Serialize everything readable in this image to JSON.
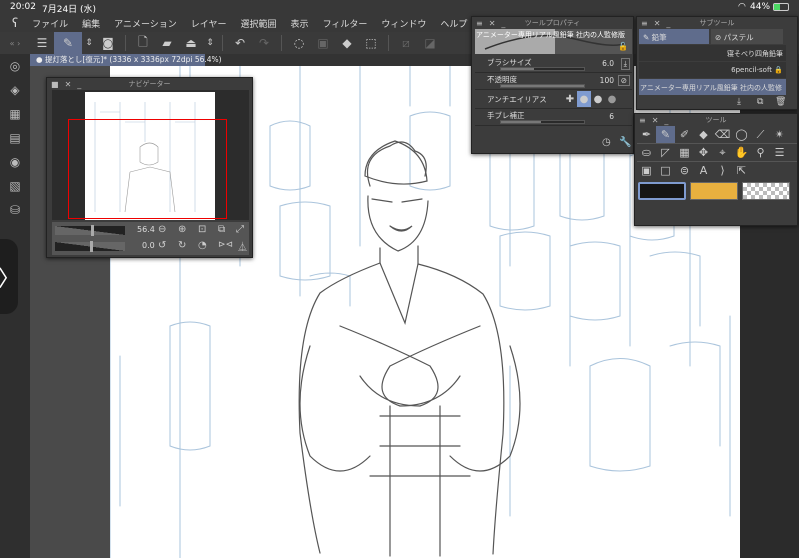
{
  "status": {
    "time": "20:02",
    "date": "7月24日 (水)",
    "battery": "44%"
  },
  "menu": [
    "ファイル",
    "編集",
    "アニメーション",
    "レイヤー",
    "選択範囲",
    "表示",
    "フィルター",
    "ウィンドウ",
    "ヘルプ"
  ],
  "document_tab": "提灯落とし[復元]* (3336 x 3336px 72dpi 56.4%)",
  "navigator": {
    "title": "ナビゲーター",
    "zoom": "56.4",
    "rotation": "0.0",
    "zoom_fraction": 0.564
  },
  "tool_property": {
    "title": "ツールプロパティ",
    "brush_name": "アニメーター専用リアル風鉛筆 社内の人監修版",
    "brush_size_label": "ブラシサイズ",
    "brush_size": "6.0",
    "brush_size_fraction": 0.4,
    "opacity_label": "不透明度",
    "opacity": "100",
    "opacity_fraction": 1.0,
    "antialias_label": "アンチエイリアス",
    "stabilization_label": "手ブレ補正",
    "stabilization": "6",
    "stabilization_fraction": 0.48
  },
  "subtool": {
    "title": "サブツール",
    "tabs": [
      "鉛筆",
      "パステル"
    ],
    "items": [
      "寝そべり四角鉛筆",
      "6pencil-soft",
      "アニメーター専用リアル風鉛筆 社内の人監修"
    ]
  },
  "tools": {
    "title": "ツール",
    "main_color": "#161616",
    "sub_color": "#e8b03f"
  },
  "colors": {
    "accent": "#5f6c8c",
    "nav_frame": "#e00000"
  }
}
